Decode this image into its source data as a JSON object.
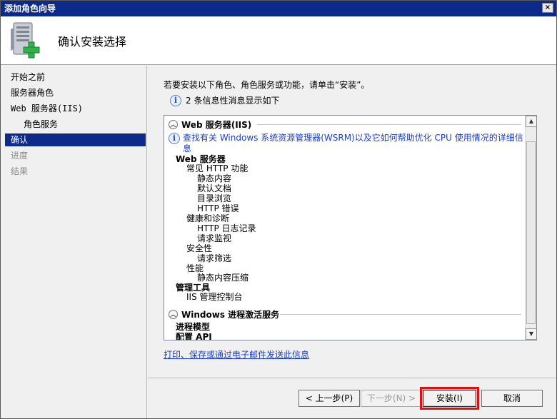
{
  "window": {
    "title": "添加角色向导",
    "close_label": "×"
  },
  "header": {
    "title": "确认安装选择",
    "icon": "server-add-icon"
  },
  "sidebar": {
    "items": [
      {
        "label": "开始之前",
        "state": "normal"
      },
      {
        "label": "服务器角色",
        "state": "normal"
      },
      {
        "label": "Web 服务器(IIS)",
        "state": "normal"
      },
      {
        "label": "角色服务",
        "state": "normal"
      },
      {
        "label": "确认",
        "state": "active"
      },
      {
        "label": "进度",
        "state": "disabled"
      },
      {
        "label": "结果",
        "state": "disabled"
      }
    ]
  },
  "main": {
    "intro": "若要安装以下角色、角色服务或功能，请单击“安装”。",
    "info_message": "2 条信息性消息显示如下",
    "sections": [
      {
        "title": "Web 服务器(IIS)",
        "link": "查找有关 Windows 系统资源管理器(WSRM)以及它如何帮助优化 CPU 使用情况的详细信息",
        "items": [
          {
            "label": "Web 服务器",
            "level": 0,
            "bold": true
          },
          {
            "label": "常见 HTTP 功能",
            "level": 1
          },
          {
            "label": "静态内容",
            "level": 2
          },
          {
            "label": "默认文档",
            "level": 2
          },
          {
            "label": "目录浏览",
            "level": 2
          },
          {
            "label": "HTTP 错误",
            "level": 2
          },
          {
            "label": "健康和诊断",
            "level": 1
          },
          {
            "label": "HTTP 日志记录",
            "level": 2
          },
          {
            "label": "请求监视",
            "level": 2
          },
          {
            "label": "安全性",
            "level": 1
          },
          {
            "label": "请求筛选",
            "level": 2
          },
          {
            "label": "性能",
            "level": 1
          },
          {
            "label": "静态内容压缩",
            "level": 2
          },
          {
            "label": "管理工具",
            "level": 0,
            "bold": true
          },
          {
            "label": "IIS 管理控制台",
            "level": 1
          }
        ]
      },
      {
        "title": "Windows 进程激活服务",
        "items": [
          {
            "label": "进程模型",
            "level": 0,
            "bold": true
          },
          {
            "label": "配置 API",
            "level": 0,
            "bold": true
          }
        ]
      }
    ],
    "bottom_link": "打印、保存或通过电子邮件发送此信息"
  },
  "footer": {
    "back": "< 上一步(P)",
    "next": "下一步(N) >",
    "install": "安装(I)",
    "cancel": "取消"
  },
  "colors": {
    "title_bar": "#0b2a8a",
    "active_step": "#0b2a8a",
    "link": "#1a3ec7",
    "highlight": "#e01010"
  }
}
